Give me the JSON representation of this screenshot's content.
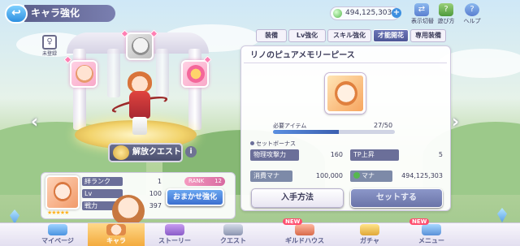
{
  "header": {
    "back_icon": "back-arrow-icon",
    "title": "キャラ強化",
    "mana": "494,125,303",
    "mana_plus": "+",
    "icons": [
      {
        "name": "display-toggle-icon",
        "label": "表示切替",
        "glyph": "⇄"
      },
      {
        "name": "help-icon",
        "label": "遊び方",
        "glyph": "?"
      },
      {
        "name": "help-book-icon",
        "label": "ヘルプ",
        "glyph": "?"
      }
    ]
  },
  "left": {
    "unregistered_label": "未登録",
    "unregistered_glyph": "♀",
    "quest_button": "解放クエスト",
    "info_glyph": "i",
    "arrow_left": "‹",
    "arrow_right": "›"
  },
  "status": {
    "bond_label": "絆ランク",
    "bond_value": "1",
    "lv_label": "Lv",
    "lv_value": "100",
    "power_label": "戦力",
    "power_value": "397",
    "rank_label": "RANK",
    "rank_value": "12",
    "auto_button": "おまかせ強化",
    "stars": "★★★★★"
  },
  "tabs": [
    {
      "label": "装備",
      "active": false
    },
    {
      "label": "Lv強化",
      "active": false
    },
    {
      "label": "スキル強化",
      "active": false
    },
    {
      "label": "才能開花",
      "active": true
    },
    {
      "label": "専用装備",
      "active": false
    }
  ],
  "panel": {
    "title": "リノのピュアメモリーピース",
    "required_label": "必要アイテム",
    "required_count": "27/50",
    "progress": 0.54,
    "set_bonus_label": "セットボーナス",
    "bonus": [
      {
        "label": "物理攻撃力",
        "value": "160"
      },
      {
        "label": "TP上昇",
        "value": "5"
      }
    ],
    "cost_label": "消費マナ",
    "cost_value": "100,000",
    "mana_label": "マナ",
    "mana_value": "494,125,303",
    "acquire_button": "入手方法",
    "set_button": "セットする"
  },
  "nav": [
    {
      "label": "マイページ",
      "active": false,
      "new": false
    },
    {
      "label": "キャラ",
      "active": true,
      "new": false
    },
    {
      "label": "ストーリー",
      "active": false,
      "new": false
    },
    {
      "label": "クエスト",
      "active": false,
      "new": false
    },
    {
      "label": "ギルドハウス",
      "active": false,
      "new": true
    },
    {
      "label": "ガチャ",
      "active": false,
      "new": false
    },
    {
      "label": "メニュー",
      "active": false,
      "new": true
    }
  ],
  "new_badge": "NEW",
  "colors": {
    "accent": "#4d5796",
    "active_nav": "#f3a93b",
    "mana": "#56b84e"
  }
}
